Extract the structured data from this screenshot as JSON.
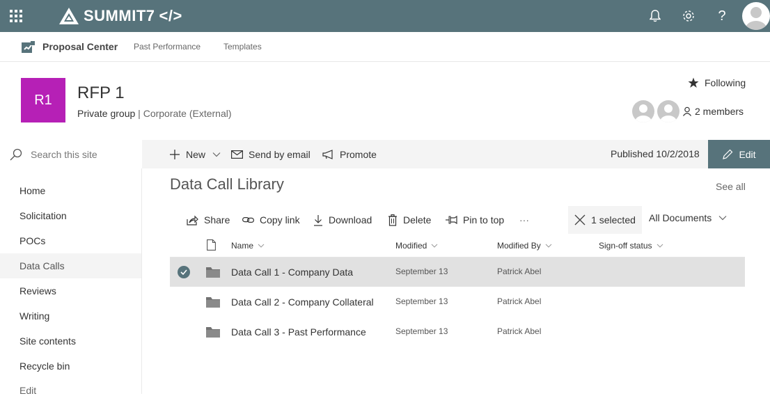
{
  "brand": {
    "name": "SUMMIT7",
    "code_symbol": "</>"
  },
  "hub": {
    "title": "Proposal Center",
    "links": [
      "Past Performance",
      "Templates"
    ]
  },
  "site": {
    "logo_text": "R1",
    "title": "RFP 1",
    "privacy": "Private group",
    "separator": "|",
    "classification": "Corporate (External)",
    "following": "Following",
    "members": "2 members",
    "logo_color": "#b620b6"
  },
  "search": {
    "placeholder": "Search this site"
  },
  "leftnav": {
    "items": [
      "Home",
      "Solicitation",
      "POCs",
      "Data Calls",
      "Reviews",
      "Writing",
      "Site contents",
      "Recycle bin",
      "Edit"
    ],
    "selected": "Data Calls"
  },
  "commandbar": {
    "new": "New",
    "send_by_email": "Send by email",
    "promote": "Promote",
    "published": "Published 10/2/2018",
    "edit": "Edit"
  },
  "library": {
    "title": "Data Call Library",
    "see_all": "See all",
    "toolbar": {
      "share": "Share",
      "copy_link": "Copy link",
      "download": "Download",
      "delete": "Delete",
      "pin_to_top": "Pin to top",
      "more": "···",
      "selected": "1 selected",
      "view": "All Documents"
    },
    "columns": {
      "name": "Name",
      "modified": "Modified",
      "modified_by": "Modified By",
      "signoff": "Sign-off status"
    },
    "rows": [
      {
        "name": "Data Call 1 - Company Data",
        "modified": "September 13",
        "modified_by": "Patrick Abel",
        "selected": true
      },
      {
        "name": "Data Call 2 - Company Collateral",
        "modified": "September 13",
        "modified_by": "Patrick Abel",
        "selected": false
      },
      {
        "name": "Data Call 3 - Past Performance",
        "modified": "September 13",
        "modified_by": "Patrick Abel",
        "selected": false
      }
    ]
  },
  "colors": {
    "suitebar": "#57737b",
    "accent": "#57737b"
  },
  "icons": [
    "waffle-icon",
    "bell-icon",
    "gear-icon",
    "help-icon",
    "avatar",
    "star-icon",
    "person-icon",
    "search-icon",
    "plus-icon",
    "mail-icon",
    "megaphone-icon",
    "pencil-icon",
    "share-icon",
    "link-icon",
    "download-icon",
    "trash-icon",
    "pin-icon",
    "close-icon",
    "folder-icon",
    "document-icon",
    "check-icon"
  ]
}
